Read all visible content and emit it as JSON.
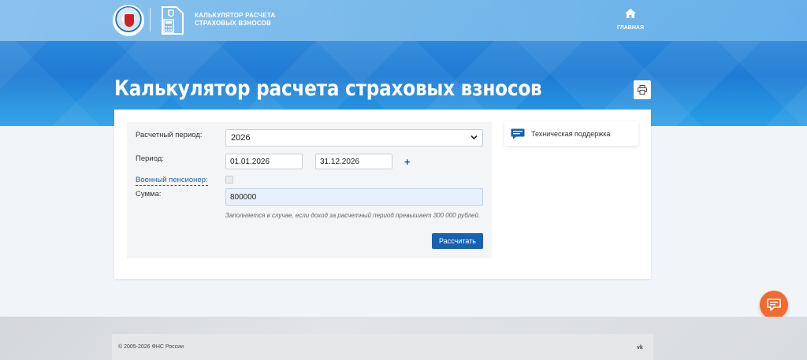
{
  "header": {
    "brand_line1": "Калькулятор расчета",
    "brand_line2": "страховых взносов",
    "nav_home_label": "ГЛАВНАЯ"
  },
  "page": {
    "title": "Калькулятор расчета страховых взносов"
  },
  "form": {
    "period_label": "Расчетный период:",
    "period_value": "2026",
    "range_label": "Период:",
    "date_from": "01.01.2026",
    "date_to": "31.12.2026",
    "add_symbol": "+",
    "military_label": "Военный пенсионер:",
    "military_checked": false,
    "sum_label": "Сумма:",
    "sum_value": "800000",
    "hint": "Заполняется в случае, если доход за расчетный период превышает 300 000 рублей.",
    "submit_label": "Рассчитать"
  },
  "sidebar": {
    "support_label": "Техническая поддержка"
  },
  "footer": {
    "copyright": "© 2005-2026 ФНС России",
    "vk_label": "vk"
  },
  "colors": {
    "accent": "#1662b0",
    "header_blue": "#2a86d9",
    "chat_orange": "#f26a2f"
  },
  "icons": [
    "home-icon",
    "print-icon",
    "chevron-down-icon",
    "support-chat-icon",
    "chat-bubble-icon",
    "vk-icon"
  ]
}
